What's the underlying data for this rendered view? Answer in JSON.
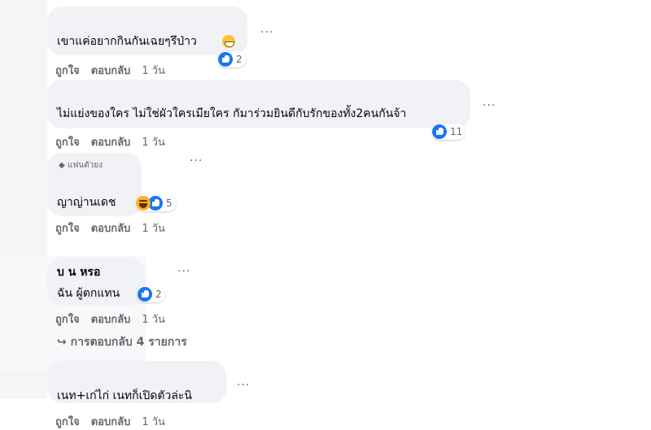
{
  "comments": [
    {
      "text": "เขาแค่อยากกินกันเฉยๆรึป่าว",
      "reaction_count": "2",
      "actions": {
        "like": "ถูกใจ",
        "reply": "ตอบกลับ",
        "time": "1 วัน"
      }
    },
    {
      "text": "ไม่แย่งของใคร ไม่ใช่ผัวใครเมียใคร กัมาร่วมยินดีกับรักของทั้ง2คนกันจ้า",
      "reaction_count": "11",
      "actions": {
        "like": "ถูกใจ",
        "reply": "ตอบกลับ",
        "time": "1 วัน"
      }
    },
    {
      "badge": "แฟนตัวยง",
      "text": "ญาญ่านเดช",
      "reaction_count": "5",
      "actions": {
        "like": "ถูกใจ",
        "reply": "ตอบกลับ",
        "time": "1 วัน"
      }
    },
    {
      "name": "บ น หรอ",
      "text": "ฉัน ผู้ตกแทน",
      "reaction_count": "2",
      "actions": {
        "like": "ถูกใจ",
        "reply": "ตอบกลับ",
        "time": "1 วัน"
      },
      "view_replies": "การตอบกลับ 4 รายการ"
    },
    {
      "text": "เนท+เก่ไก่ เนทก็เปิดตัวล่ะนิ",
      "actions": {
        "like": "ถูกใจ",
        "reply": "ตอบกลับ",
        "time": "1 วัน"
      }
    }
  ],
  "more_label": "···",
  "icons": {
    "like": "like-icon",
    "haha": "haha-icon",
    "grin": "grin-emoji-icon",
    "badge": "diamond-icon",
    "reply_arrow": "reply-arrow-icon"
  },
  "colors": {
    "bubble": "#f0f2f5",
    "like_blue": "#1877f2",
    "meta_text": "#65676b"
  }
}
